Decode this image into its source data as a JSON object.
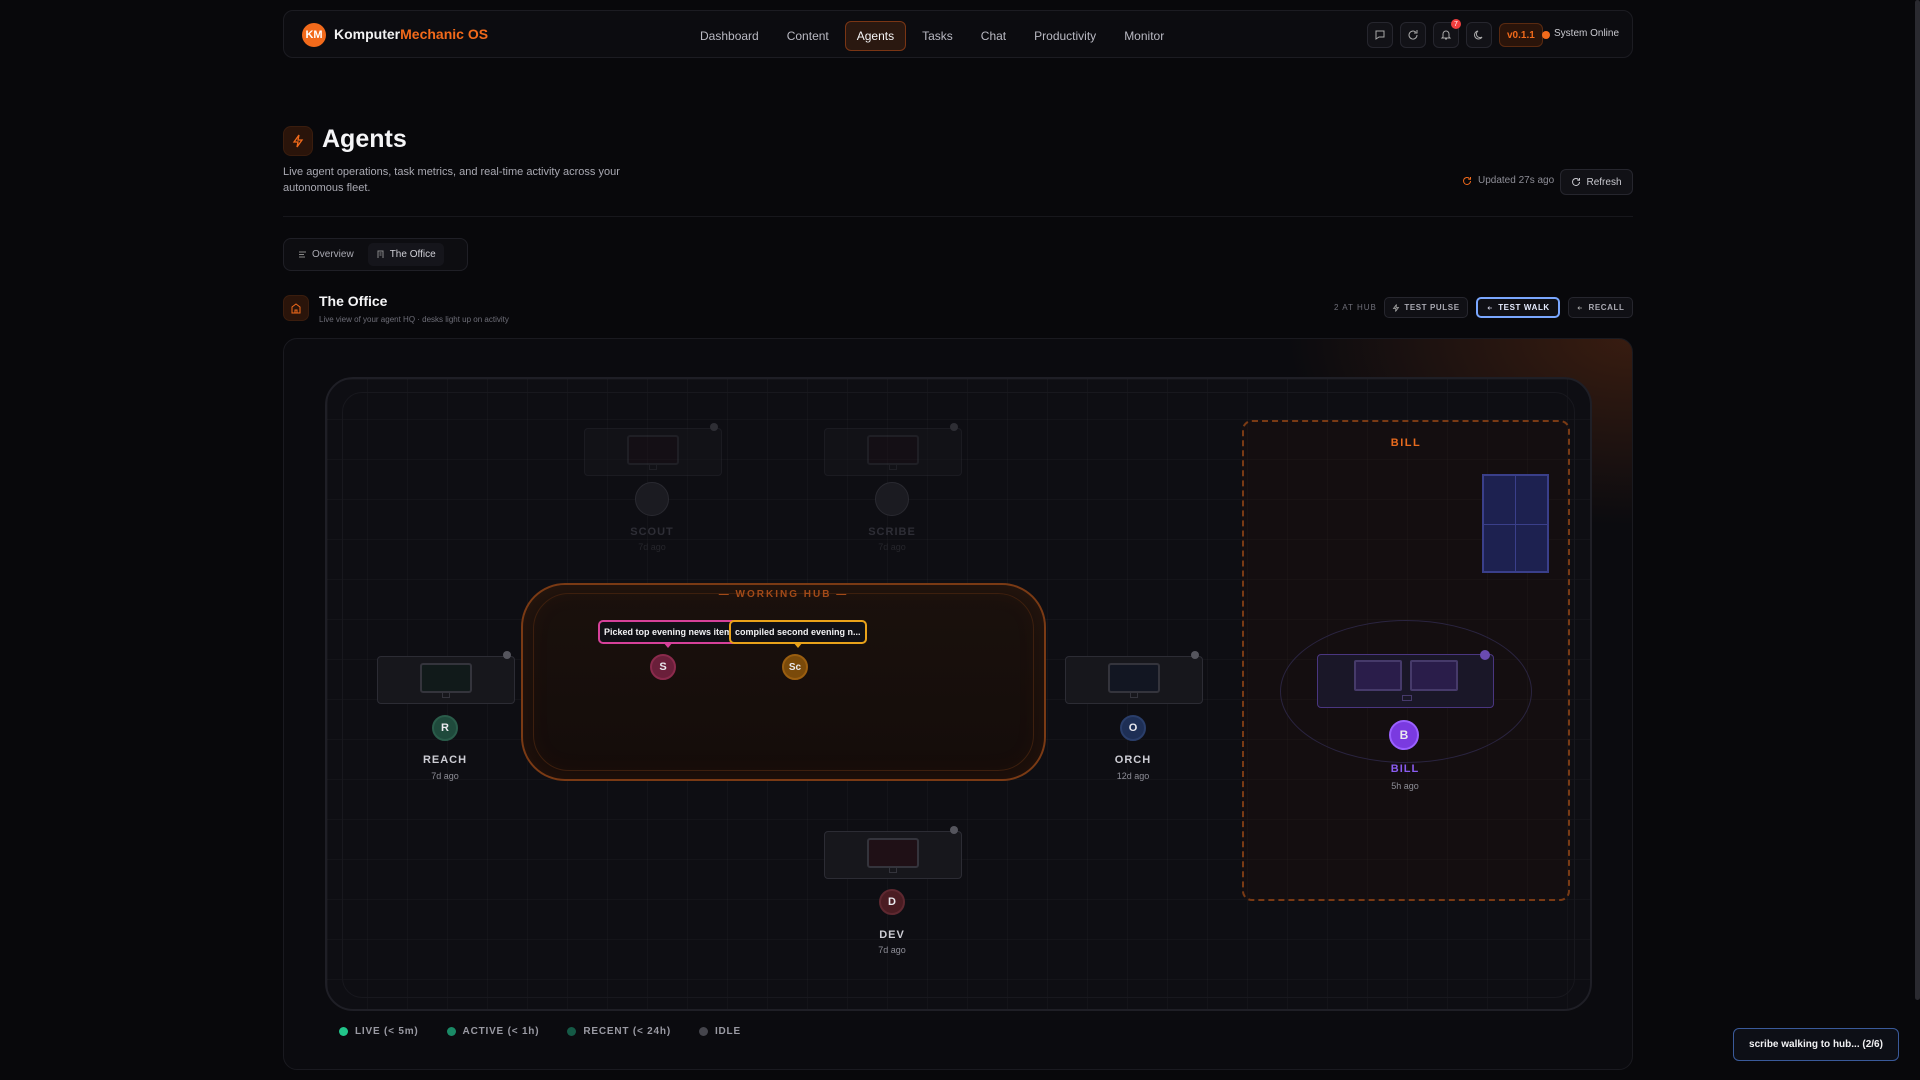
{
  "brand": {
    "logo": "KM",
    "name_a": "Komputer",
    "name_b": "Mechanic OS"
  },
  "nav": [
    {
      "label": "Dashboard"
    },
    {
      "label": "Content"
    },
    {
      "label": "Agents",
      "active": true
    },
    {
      "label": "Tasks"
    },
    {
      "label": "Chat"
    },
    {
      "label": "Productivity"
    },
    {
      "label": "Monitor"
    }
  ],
  "header_icons": [
    "chat-icon",
    "refresh-icon",
    "bell-icon",
    "moon-icon"
  ],
  "notifications": {
    "count": "7"
  },
  "version": "v0.1.1",
  "system_status": "System Online",
  "page": {
    "title": "Agents",
    "description": "Live agent operations, task metrics, and real-time activity across your autonomous fleet.",
    "updated": "Updated 27s ago",
    "refresh_label": "Refresh"
  },
  "tabs": [
    {
      "label": "Overview"
    },
    {
      "label": "The Office",
      "active": true
    }
  ],
  "office": {
    "title": "The Office",
    "subtitle": "Live view of your agent HQ · desks light up on activity",
    "at_hub": "2 AT HUB",
    "buttons": {
      "test_pulse": "TEST PULSE",
      "test_walk": "TEST WALK",
      "recall": "RECALL"
    },
    "hub_label": "— WORKING HUB —",
    "bill_room_label": "BILL"
  },
  "agents": [
    {
      "id": "scout",
      "name": "SCOUT",
      "time": "7d ago",
      "status": "away"
    },
    {
      "id": "scribe",
      "name": "SCRIBE",
      "time": "7d ago",
      "status": "away"
    },
    {
      "id": "reach",
      "initial": "R",
      "name": "REACH",
      "time": "7d ago",
      "color": "#1f4a3c"
    },
    {
      "id": "orch",
      "initial": "O",
      "name": "ORCH",
      "time": "12d ago",
      "color": "#1e2f55"
    },
    {
      "id": "dev",
      "initial": "D",
      "name": "DEV",
      "time": "7d ago",
      "color": "#4a1c22"
    },
    {
      "id": "bill",
      "initial": "B",
      "name": "BILL",
      "time": "5h ago",
      "color": "#7a3ae0"
    }
  ],
  "hub_agents": [
    {
      "initial": "S",
      "bubble": "Picked top evening news item",
      "color": "#6a1f3a",
      "bubble_color": "#d6419a"
    },
    {
      "initial": "Sc",
      "bubble": "compiled second evening n...",
      "color": "#7a4a0a",
      "bubble_color": "#e8a21a"
    }
  ],
  "legend": [
    {
      "label": "LIVE (< 5m)",
      "color": "#22c58a"
    },
    {
      "label": "ACTIVE (< 1h)",
      "color": "#1a8a66"
    },
    {
      "label": "RECENT (< 24h)",
      "color": "#155a46"
    },
    {
      "label": "IDLE",
      "color": "#45454c"
    }
  ],
  "toast": "scribe walking to hub... (2/6)"
}
